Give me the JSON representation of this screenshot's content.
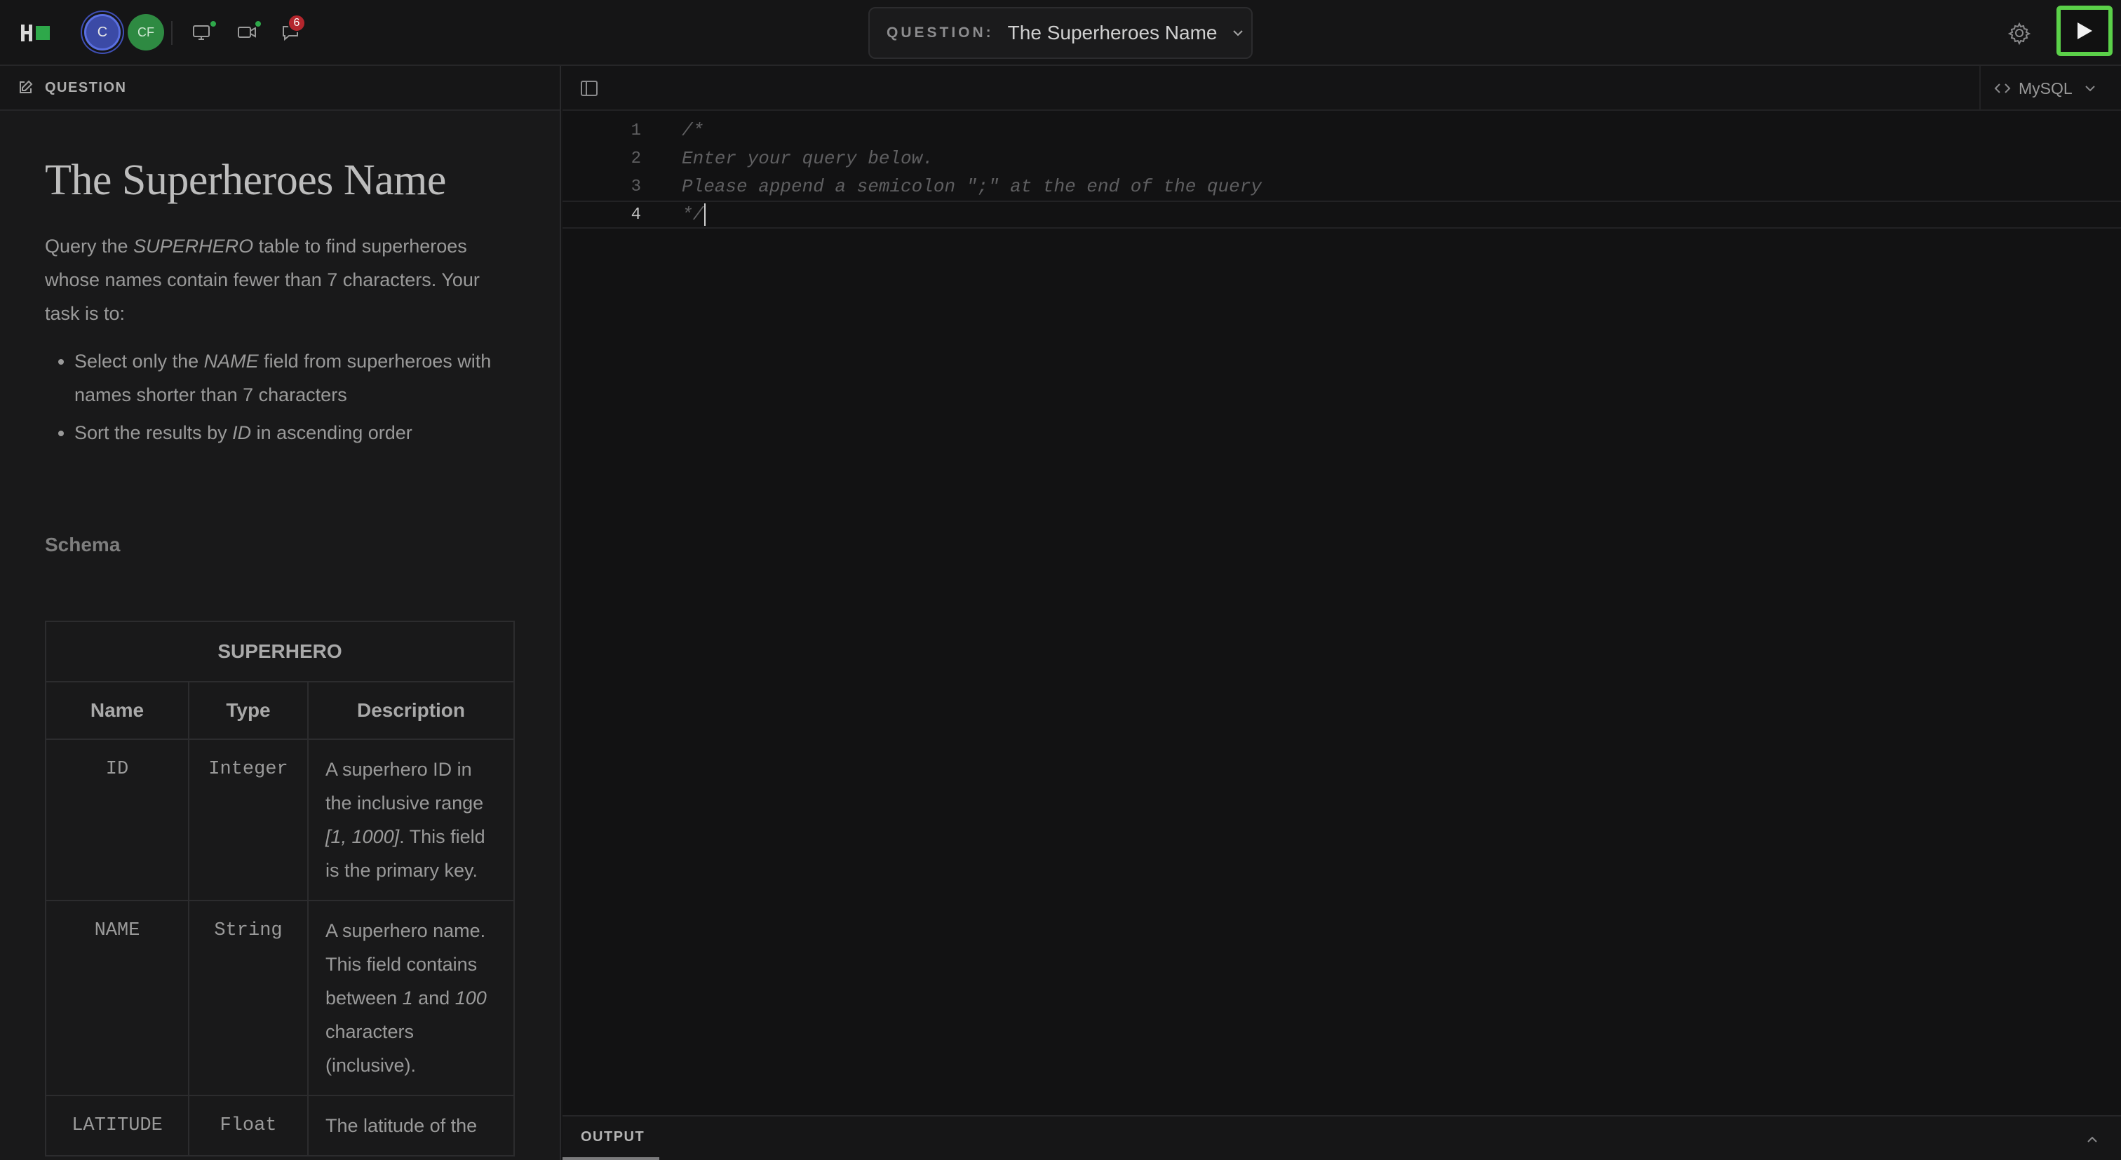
{
  "topbar": {
    "logo_icon": "hackerrank-logo-icon",
    "avatars": [
      {
        "initials": "C",
        "color": "#3b4aa6"
      },
      {
        "initials": "CF",
        "color": "#2e8a42"
      }
    ],
    "icons": [
      "screen-share-icon",
      "video-camera-icon",
      "chat-icon"
    ],
    "notification_count": "6",
    "question_label": "QUESTION:",
    "question_title": "The Superheroes Name",
    "settings_icon": "gear-icon",
    "run_icon": "play-icon",
    "accent_color": "#5bd149"
  },
  "left_panel": {
    "header_label": "QUESTION",
    "title": "The Superheroes Name",
    "description": {
      "part1": "Query the ",
      "em1": "SUPERHERO",
      "part2": " table to find superheroes whose names contain fewer than 7 characters. Your task is to:"
    },
    "tasks": [
      {
        "pre": "Select only the ",
        "em": "NAME",
        "post": " field from superheroes with names shorter than 7 characters"
      },
      {
        "pre": "Sort the results by ",
        "em": "ID",
        "post": " in ascending order"
      }
    ],
    "schema_heading": "Schema",
    "schema_table": {
      "name": "SUPERHERO",
      "headers": [
        "Name",
        "Type",
        "Description"
      ],
      "rows": [
        {
          "name": "ID",
          "type": "Integer",
          "desc_pre": "A superhero ID in the inclusive range ",
          "desc_em": "[1, 1000]",
          "desc_mid": ". This field is the primary key.",
          "desc_em2": "",
          "desc_post": ""
        },
        {
          "name": "NAME",
          "type": "String",
          "desc_pre": "A superhero name. This field contains between ",
          "desc_em": "1",
          "desc_mid": " and ",
          "desc_em2": "100",
          "desc_post": " characters (inclusive)."
        },
        {
          "name": "LATITUDE",
          "type": "Float",
          "desc_pre": "The latitude of the",
          "desc_em": "",
          "desc_mid": "",
          "desc_em2": "",
          "desc_post": ""
        }
      ]
    }
  },
  "editor": {
    "language": "MySQL",
    "lines": [
      {
        "no": "1",
        "text": "/*"
      },
      {
        "no": "2",
        "text": "Enter your query below."
      },
      {
        "no": "3",
        "text": "Please append a semicolon \";\" at the end of the query"
      },
      {
        "no": "4",
        "text": "*/"
      }
    ],
    "active_line": 4
  },
  "output": {
    "tab_label": "OUTPUT"
  }
}
